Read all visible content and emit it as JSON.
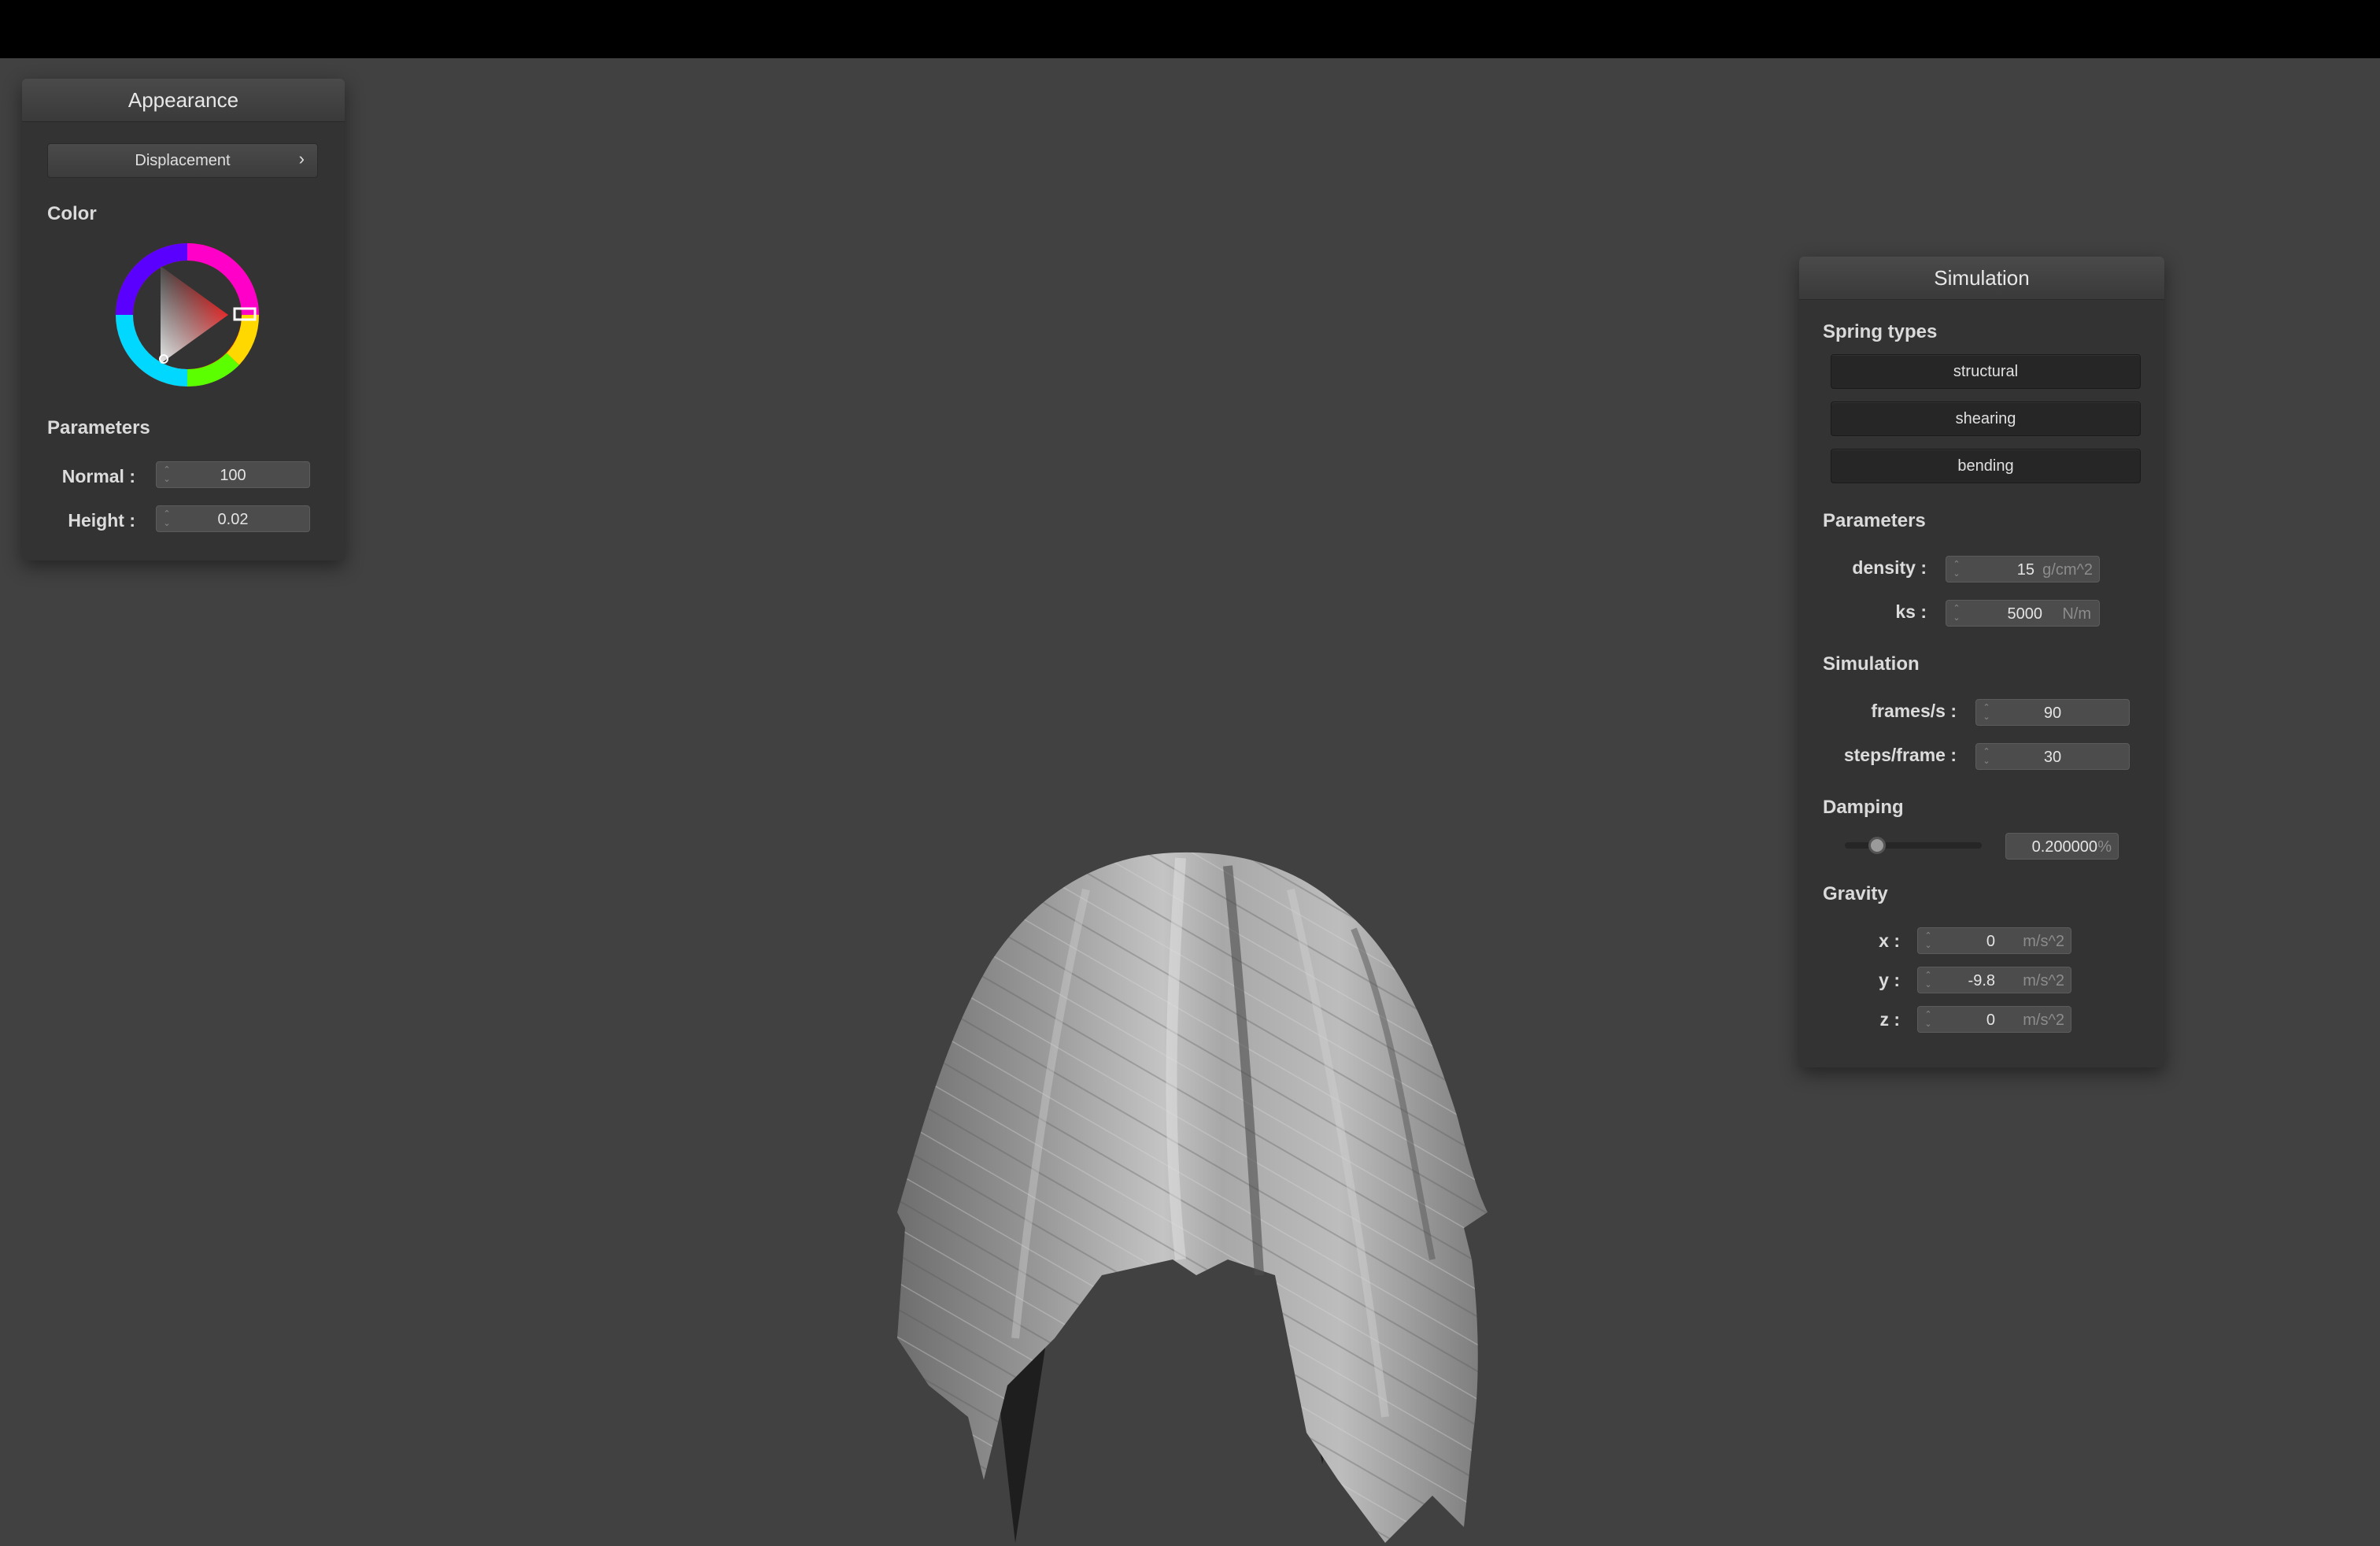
{
  "appearance": {
    "title": "Appearance",
    "mode_dropdown": {
      "label": "Displacement",
      "chevron": "›"
    },
    "color_label": "Color",
    "color_wheel": {
      "hue_color": "#e82c2c"
    },
    "parameters_label": "Parameters",
    "normal": {
      "label": "Normal :",
      "value": "100"
    },
    "height": {
      "label": "Height :",
      "value": "0.02"
    }
  },
  "simulation_panel": {
    "title": "Simulation",
    "spring_types_label": "Spring types",
    "spring_buttons": [
      "structural",
      "shearing",
      "bending"
    ],
    "parameters_label": "Parameters",
    "density": {
      "label": "density :",
      "value": "15",
      "unit": "g/cm^2"
    },
    "ks": {
      "label": "ks :",
      "value": "5000",
      "unit": "N/m"
    },
    "simulation_label": "Simulation",
    "frames_per_s": {
      "label": "frames/s :",
      "value": "90"
    },
    "steps_per_frame": {
      "label": "steps/frame :",
      "value": "30"
    },
    "damping_label": "Damping",
    "damping": {
      "value": "0.200000",
      "unit": "%",
      "slider_fraction": 0.2
    },
    "gravity_label": "Gravity",
    "gravity": {
      "x": {
        "label": "x :",
        "value": "0",
        "unit": "m/s^2"
      },
      "y": {
        "label": "y :",
        "value": "-9.8",
        "unit": "m/s^2"
      },
      "z": {
        "label": "z :",
        "value": "0",
        "unit": "m/s^2"
      }
    }
  },
  "colors": {
    "background": "#414141",
    "panel": "#333333",
    "topbar": "#000000"
  }
}
